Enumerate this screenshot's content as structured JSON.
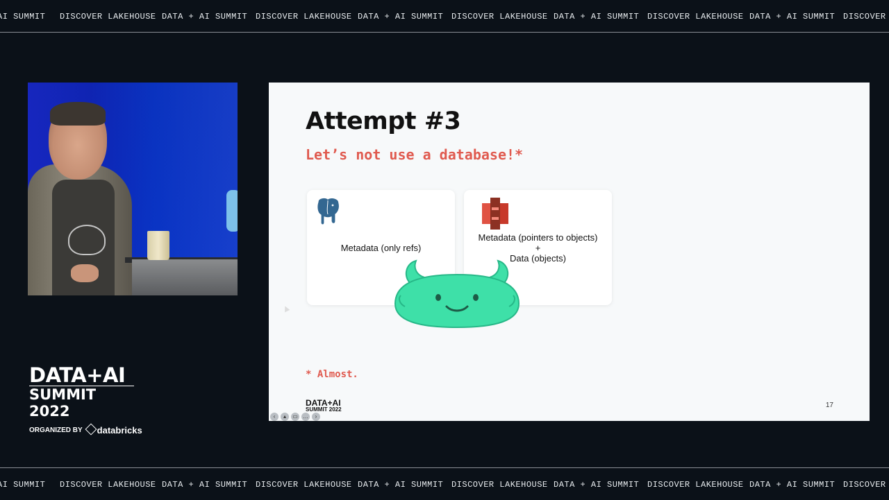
{
  "ticker": {
    "items": [
      "AI SUMMIT",
      "DISCOVER LAKEHOUSE",
      "DATA + AI SUMMIT",
      "DISCOVER LAKEHOUSE",
      "DATA + AI SUMMIT",
      "DISCOVER LAKEHOUSE",
      "DATA + AI SUMMIT",
      "DISCOVER LAKEHOUSE",
      "DATA + AI SUMMIT",
      "DISCOVER LA"
    ]
  },
  "slide": {
    "title": "Attempt #3",
    "subtitle": "Let’s not use a database!*",
    "cards": {
      "postgres_label": "Metadata (only refs)",
      "s3_line1": "Metadata (pointers to objects)",
      "s3_line2": "+",
      "s3_line3": "Data (objects)"
    },
    "footnote": "* Almost.",
    "logo_line1": "DATA+AI",
    "logo_line2": "SUMMIT 2022",
    "page_number": "17",
    "icons": [
      "postgresql-elephant-icon",
      "aws-s3-bucket-icon",
      "mascot-icon"
    ]
  },
  "event_logo": {
    "line1": "DATA+AI",
    "line2": "SUMMIT 2022",
    "organized_by": "ORGANIZED BY",
    "brand": "databricks"
  },
  "colors": {
    "background": "#0b1118",
    "accent_red": "#e05a4f",
    "mascot_green": "#3ee0a8"
  }
}
